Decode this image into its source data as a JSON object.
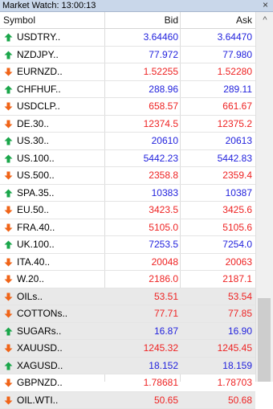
{
  "window": {
    "title": "Market Watch: 13:00:13",
    "close_glyph": "×"
  },
  "columns": {
    "symbol": "Symbol",
    "bid": "Bid",
    "ask": "Ask"
  },
  "colors": {
    "up": "#2222dd",
    "down": "#ee2222",
    "arrow_up": "#1aa64a",
    "arrow_down": "#f06418",
    "shaded_row": "#e9e9e9"
  },
  "rows": [
    {
      "symbol": "USDTRY..",
      "bid": "3.64460",
      "ask": "3.64470",
      "dir": "up",
      "shaded": false
    },
    {
      "symbol": "NZDJPY..",
      "bid": "77.972",
      "ask": "77.980",
      "dir": "up",
      "shaded": false
    },
    {
      "symbol": "EURNZD..",
      "bid": "1.52255",
      "ask": "1.52280",
      "dir": "down",
      "shaded": false
    },
    {
      "symbol": "CHFHUF..",
      "bid": "288.96",
      "ask": "289.11",
      "dir": "up",
      "shaded": false
    },
    {
      "symbol": "USDCLP..",
      "bid": "658.57",
      "ask": "661.67",
      "dir": "down",
      "shaded": false
    },
    {
      "symbol": "DE.30..",
      "bid": "12374.5",
      "ask": "12375.2",
      "dir": "down",
      "shaded": false
    },
    {
      "symbol": "US.30..",
      "bid": "20610",
      "ask": "20613",
      "dir": "up",
      "shaded": false
    },
    {
      "symbol": "US.100..",
      "bid": "5442.23",
      "ask": "5442.83",
      "dir": "up",
      "shaded": false
    },
    {
      "symbol": "US.500..",
      "bid": "2358.8",
      "ask": "2359.4",
      "dir": "down",
      "shaded": false
    },
    {
      "symbol": "SPA.35..",
      "bid": "10383",
      "ask": "10387",
      "dir": "up",
      "shaded": false
    },
    {
      "symbol": "EU.50..",
      "bid": "3423.5",
      "ask": "3425.6",
      "dir": "down",
      "shaded": false
    },
    {
      "symbol": "FRA.40..",
      "bid": "5105.0",
      "ask": "5105.6",
      "dir": "down",
      "shaded": false
    },
    {
      "symbol": "UK.100..",
      "bid": "7253.5",
      "ask": "7254.0",
      "dir": "up",
      "shaded": false
    },
    {
      "symbol": "ITA.40..",
      "bid": "20048",
      "ask": "20063",
      "dir": "down",
      "shaded": false
    },
    {
      "symbol": "W.20..",
      "bid": "2186.0",
      "ask": "2187.1",
      "dir": "down",
      "shaded": false
    },
    {
      "symbol": "OILs..",
      "bid": "53.51",
      "ask": "53.54",
      "dir": "down",
      "shaded": true
    },
    {
      "symbol": "COTTONs..",
      "bid": "77.71",
      "ask": "77.85",
      "dir": "down",
      "shaded": true
    },
    {
      "symbol": "SUGARs..",
      "bid": "16.87",
      "ask": "16.90",
      "dir": "up",
      "shaded": true
    },
    {
      "symbol": "XAUUSD..",
      "bid": "1245.32",
      "ask": "1245.45",
      "dir": "down",
      "shaded": true
    },
    {
      "symbol": "XAGUSD..",
      "bid": "18.152",
      "ask": "18.159",
      "dir": "up",
      "shaded": true
    },
    {
      "symbol": "GBPNZD..",
      "bid": "1.78681",
      "ask": "1.78703",
      "dir": "down",
      "shaded": false
    },
    {
      "symbol": "OIL.WTI..",
      "bid": "50.65",
      "ask": "50.68",
      "dir": "down",
      "shaded": true
    }
  ],
  "scrollbar": {
    "up_glyph": "^"
  }
}
